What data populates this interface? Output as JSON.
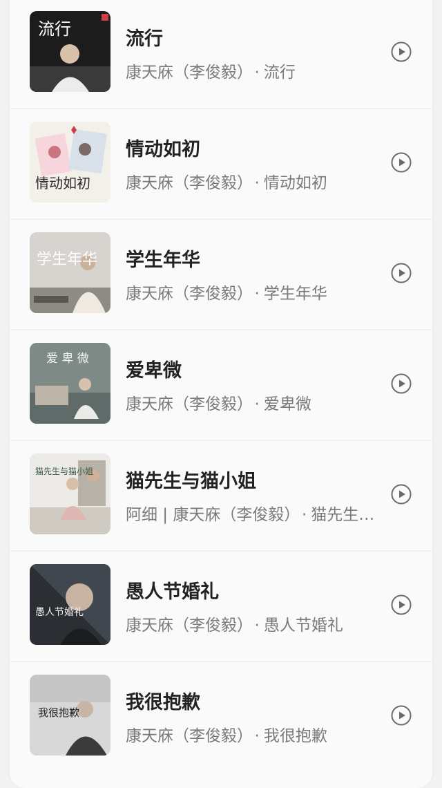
{
  "songs": [
    {
      "title": "流行",
      "artist": "康天庥（李俊毅）",
      "separator": "·",
      "album": "流行",
      "cover_text": "流行"
    },
    {
      "title": "情动如初",
      "artist": "康天庥（李俊毅）",
      "separator": "·",
      "album": "情动如初",
      "cover_text": "情动如初"
    },
    {
      "title": "学生年华",
      "artist": "康天庥（李俊毅）",
      "separator": "·",
      "album": "学生年华",
      "cover_text": "学生年华"
    },
    {
      "title": "爱卑微",
      "artist": "康天庥（李俊毅）",
      "separator": "·",
      "album": "爱卑微",
      "cover_text": "爱 卑 微"
    },
    {
      "title": "猫先生与猫小姐",
      "artist": "阿细 | 康天庥（李俊毅）",
      "separator": "·",
      "album": "猫先生与猫小姐",
      "cover_text": "猫先生与猫小姐"
    },
    {
      "title": "愚人节婚礼",
      "artist": "康天庥（李俊毅）",
      "separator": "·",
      "album": "愚人节婚礼",
      "cover_text": "愚人节婚礼"
    },
    {
      "title": "我很抱歉",
      "artist": "康天庥（李俊毅）",
      "separator": "·",
      "album": "我很抱歉",
      "cover_text": "我很抱歉"
    }
  ],
  "icons": {
    "play": "play-circle-icon"
  },
  "colors": {
    "title": "#222222",
    "subtitle": "#7a7a7a",
    "icon": "#6b6b6b"
  }
}
